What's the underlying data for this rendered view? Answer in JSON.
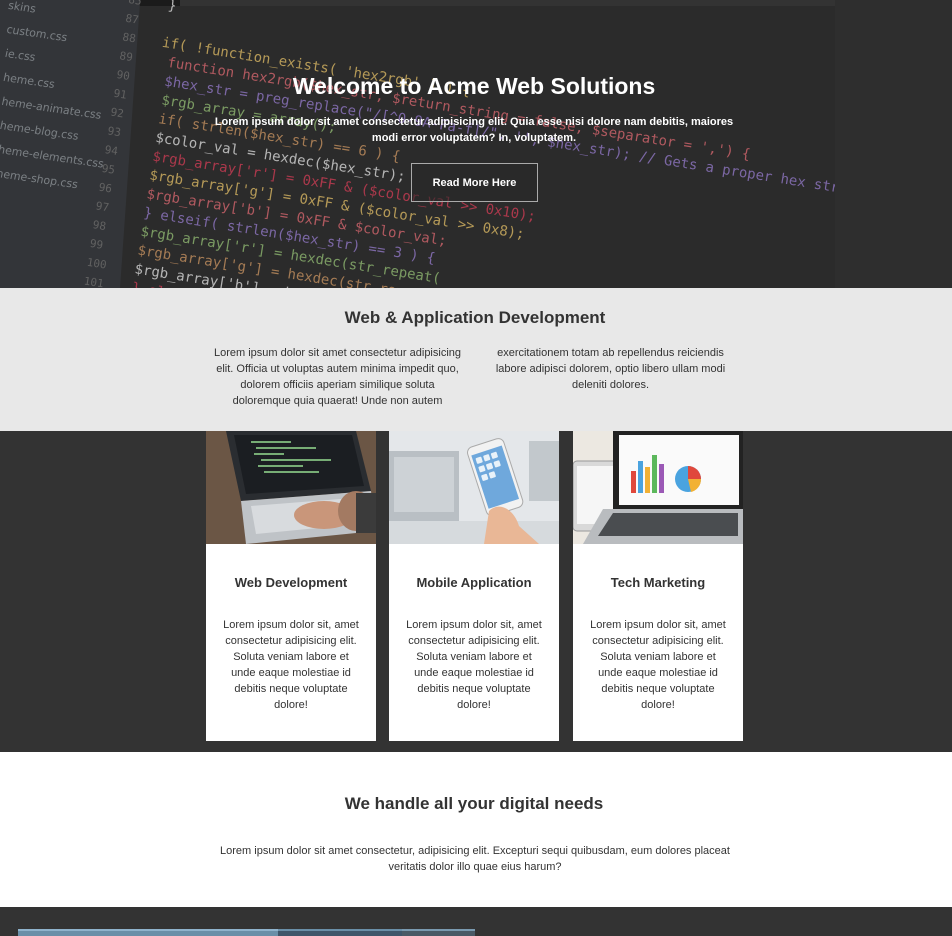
{
  "hero": {
    "title": "Welcome to Acme Web Solutions",
    "text": "Lorem ipsum dolor sit amet consectetur adipisicing elit. Quia esse nisi dolore nam debitis, maiores modi error voluptatem? In, voluptatem.",
    "button_label": "Read More Here",
    "sidebar_files": [
      "skins",
      "custom.css",
      "ie.css",
      "heme.css",
      "heme-animate.css",
      "heme-blog.css",
      "heme-elements.css",
      "heme-shop.css"
    ],
    "code_lines": [
      {
        "n": "85",
        "code": "}"
      },
      {
        "n": "87",
        "code": ""
      },
      {
        "n": "88",
        "code": "if( !function_exists( 'hex2rgb' ) ) {"
      },
      {
        "n": "89",
        "code": "  function hex2rgb($hex_str, $return_string = false, $separator = ',') {"
      },
      {
        "n": "90",
        "code": "    $hex_str = preg_replace(\"/[^0-9A-Fa-f]/\", '', $hex_str); // Gets a proper hex string"
      },
      {
        "n": "91",
        "code": "    $rgb_array = array();"
      },
      {
        "n": "92",
        "code": "    if( strlen($hex_str) == 6 ) {"
      },
      {
        "n": "93",
        "code": "      $color_val = hexdec($hex_str);"
      },
      {
        "n": "94",
        "code": "      $rgb_array['r'] = 0xFF & ($color_val >> 0x10);"
      },
      {
        "n": "95",
        "code": "      $rgb_array['g'] = 0xFF & ($color_val >> 0x8);"
      },
      {
        "n": "96",
        "code": "      $rgb_array['b'] = 0xFF & $color_val;"
      },
      {
        "n": "97",
        "code": "    } elseif( strlen($hex_str) == 3 ) {"
      },
      {
        "n": "98",
        "code": "      $rgb_array['r'] = hexdec(str_repeat("
      },
      {
        "n": "99",
        "code": "      $rgb_array['g'] = hexdec(str_repeat("
      },
      {
        "n": "100",
        "code": "      $rgb_array['b'] = hexdec(str_repeat("
      },
      {
        "n": "101",
        "code": "    } else {"
      }
    ]
  },
  "development": {
    "title": "Web & Application Development",
    "text": "Lorem ipsum dolor sit amet consectetur adipisicing elit. Officia ut voluptas autem minima impedit quo, dolorem officiis aperiam similique soluta doloremque quia quaerat! Unde non autem exercitationem totam ab repellendus reiciendis labore adipisci dolorem, optio libero ullam modi deleniti dolores."
  },
  "cards": [
    {
      "title": "Web Development",
      "text": "Lorem ipsum dolor sit, amet consectetur adipisicing elit. Soluta veniam labore et unde eaque molestiae id debitis neque voluptate dolore!",
      "image": "laptop-coding-photo"
    },
    {
      "title": "Mobile Application",
      "text": "Lorem ipsum dolor sit, amet consectetur adipisicing elit. Soluta veniam labore et unde eaque molestiae id debitis neque voluptate dolore!",
      "image": "smartphone-photo"
    },
    {
      "title": "Tech Marketing",
      "text": "Lorem ipsum dolor sit, amet consectetur adipisicing elit. Soluta veniam labore et unde eaque molestiae id debitis neque voluptate dolore!",
      "image": "laptop-charts-photo"
    }
  ],
  "digital": {
    "title": "We handle all your digital needs",
    "text": "Lorem ipsum dolor sit amet consectetur, adipisicing elit. Excepturi sequi quibusdam, eum dolores placeat veritatis dolor illo quae eius harum?"
  },
  "colors": {
    "dark_bg": "#333333",
    "light_section": "#e8e8e8",
    "card_bg": "#ffffff",
    "accent_blue": "#6a8fa8"
  }
}
